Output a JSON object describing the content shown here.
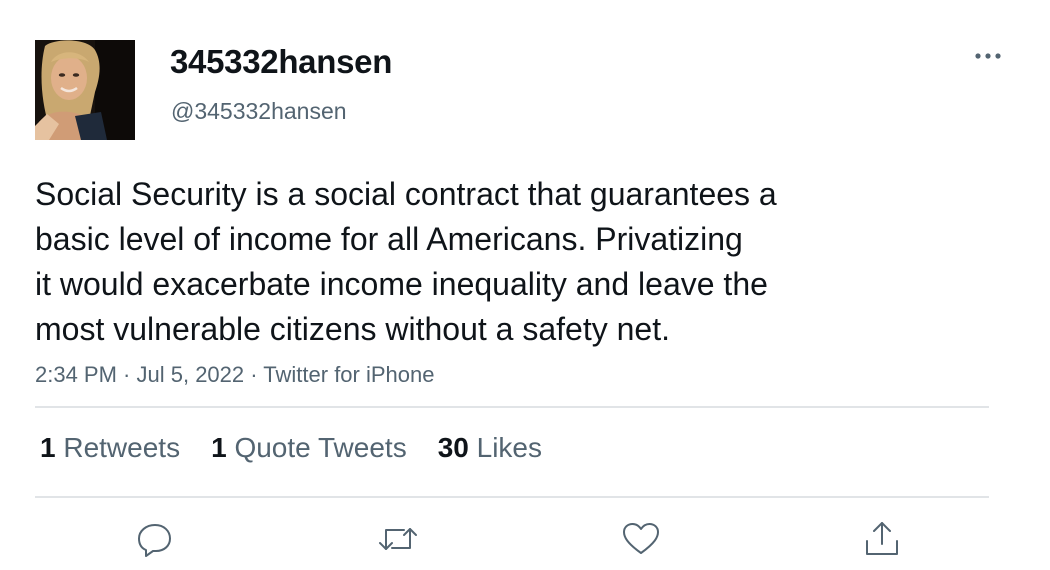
{
  "user": {
    "display_name": "345332hansen",
    "handle": "@345332hansen"
  },
  "tweet": {
    "text": "Social Security is a social contract that guarantees a\nbasic level of income for all Americans. Privatizing\nit would exacerbate income inequality and leave the\nmost vulnerable citizens without a safety net.",
    "time": "2:34 PM",
    "date": "Jul 5, 2022",
    "source": "Twitter for iPhone",
    "separator": " · "
  },
  "stats": {
    "retweets_count": "1",
    "retweets_label": "Retweets",
    "quotes_count": "1",
    "quotes_label": "Quote Tweets",
    "likes_count": "30",
    "likes_label": "Likes"
  },
  "icons": {
    "more": "more-dots-icon",
    "reply": "reply-bubble-icon",
    "retweet": "retweet-arrows-icon",
    "like": "heart-icon",
    "share": "share-upload-icon"
  },
  "colors": {
    "primary_text": "#0f1419",
    "secondary_text": "#536471",
    "divider": "#e1e4e7"
  }
}
